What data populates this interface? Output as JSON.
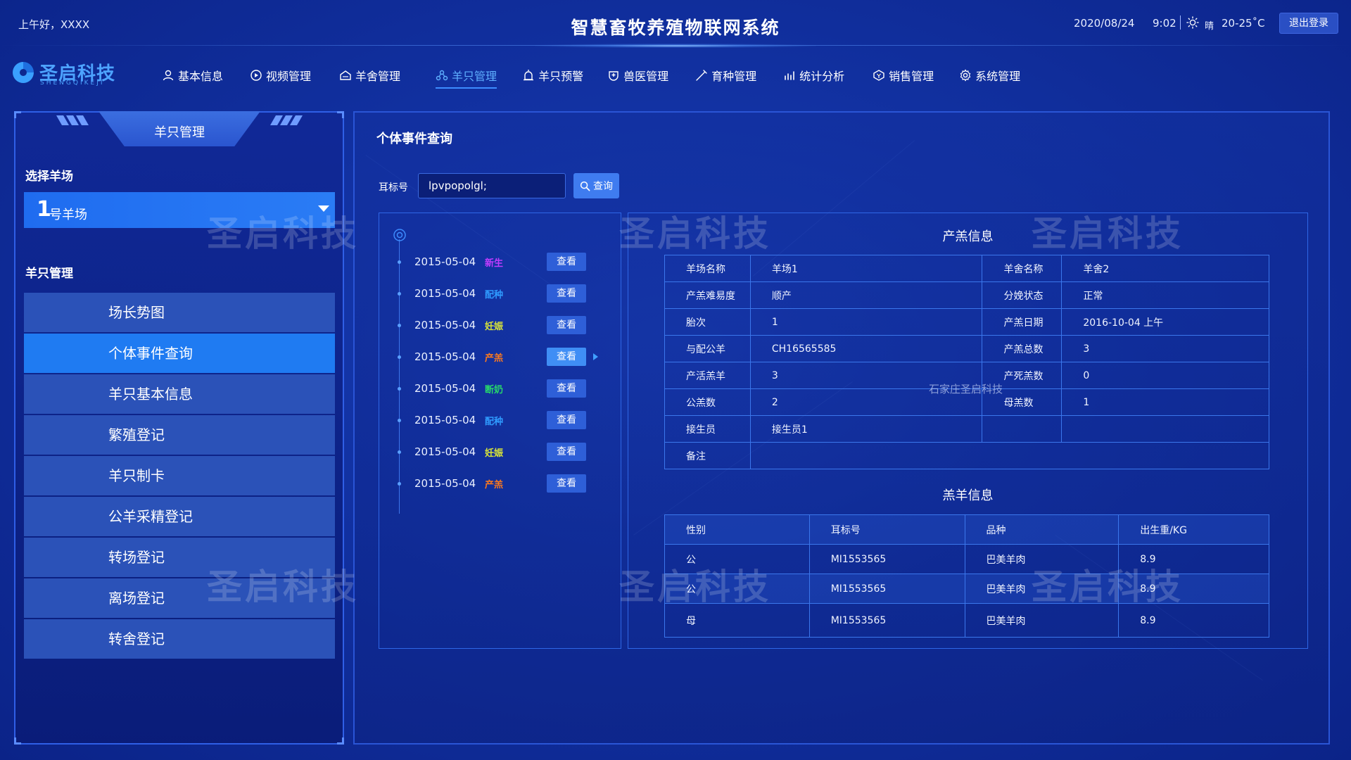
{
  "header": {
    "greeting": "上午好，XXXX",
    "title": "智慧畜牧养殖物联网系统",
    "date": "2020/08/24",
    "time": "9:02",
    "weather": "晴",
    "temperature": "20-25˚C",
    "logout_label": "退出登录"
  },
  "logo": {
    "name": "圣启科技",
    "sub": "SHENGQIKEJI"
  },
  "nav": [
    {
      "label": "基本信息",
      "icon": "user-icon"
    },
    {
      "label": "视频管理",
      "icon": "play-icon"
    },
    {
      "label": "羊舍管理",
      "icon": "barn-icon"
    },
    {
      "label": "羊只管理",
      "icon": "sheep-icon",
      "active": true
    },
    {
      "label": "羊只预警",
      "icon": "alarm-icon"
    },
    {
      "label": "兽医管理",
      "icon": "vet-icon"
    },
    {
      "label": "育种管理",
      "icon": "syringe-icon"
    },
    {
      "label": "统计分析",
      "icon": "chart-icon"
    },
    {
      "label": "销售管理",
      "icon": "sales-icon"
    },
    {
      "label": "系统管理",
      "icon": "gear-icon"
    }
  ],
  "sidebar": {
    "tab_title": "羊只管理",
    "farm_label": "选择羊场",
    "farm_number": "1",
    "farm_suffix": "号羊场",
    "menu_label": "羊只管理",
    "items": [
      {
        "label": "场长势图"
      },
      {
        "label": "个体事件查询",
        "active": true
      },
      {
        "label": "羊只基本信息"
      },
      {
        "label": "繁殖登记"
      },
      {
        "label": "羊只制卡"
      },
      {
        "label": "公羊采精登记"
      },
      {
        "label": "转场登记"
      },
      {
        "label": "离场登记"
      },
      {
        "label": "转舍登记"
      }
    ]
  },
  "watermark": "圣启科技",
  "main": {
    "title": "个体事件查询",
    "search": {
      "label": "耳标号",
      "value": "lpvpopolgl;",
      "button": "查询"
    },
    "timeline": [
      {
        "date": "2015-05-04",
        "type": "新生",
        "color": "#c03cff",
        "btn": "查看"
      },
      {
        "date": "2015-05-04",
        "type": "配种",
        "color": "#2f9bff",
        "btn": "查看"
      },
      {
        "date": "2015-05-04",
        "type": "妊娠",
        "color": "#d6e23a",
        "btn": "查看"
      },
      {
        "date": "2015-05-04",
        "type": "产羔",
        "color": "#ff7a1c",
        "btn": "查看",
        "active": true
      },
      {
        "date": "2015-05-04",
        "type": "断奶",
        "color": "#27d86a",
        "btn": "查看"
      },
      {
        "date": "2015-05-04",
        "type": "配种",
        "color": "#2f9bff",
        "btn": "查看"
      },
      {
        "date": "2015-05-04",
        "type": "妊娠",
        "color": "#d6e23a",
        "btn": "查看"
      },
      {
        "date": "2015-05-04",
        "type": "产羔",
        "color": "#ff7a1c",
        "btn": "查看"
      }
    ],
    "birth_info": {
      "title": "产羔信息",
      "rows": [
        [
          "羊场名称",
          "羊场1",
          "羊舍名称",
          "羊舍2"
        ],
        [
          "产羔难易度",
          "顺产",
          "分娩状态",
          "正常"
        ],
        [
          "胎次",
          "1",
          "产羔日期",
          "2016-10-04   上午"
        ],
        [
          "与配公羊",
          "CH16565585",
          "产羔总数",
          "3"
        ],
        [
          "产活羔羊",
          "3",
          "产死羔数",
          "0"
        ],
        [
          "公羔数",
          "2",
          "母羔数",
          "1"
        ],
        [
          "接生员",
          "接生员1",
          "",
          ""
        ],
        [
          "备注",
          "",
          "",
          ""
        ]
      ],
      "center_watermark": "石家庄圣启科技"
    },
    "lamb_info": {
      "title": "羔羊信息",
      "headers": [
        "性别",
        "耳标号",
        "品种",
        "出生重/KG"
      ],
      "rows": [
        [
          "公",
          "MI1553565",
          "巴美羊肉",
          "8.9"
        ],
        [
          "公",
          "MI1553565",
          "巴美羊肉",
          "8.9"
        ],
        [
          "母",
          "MI1553565",
          "巴美羊肉",
          "8.9"
        ]
      ]
    }
  }
}
